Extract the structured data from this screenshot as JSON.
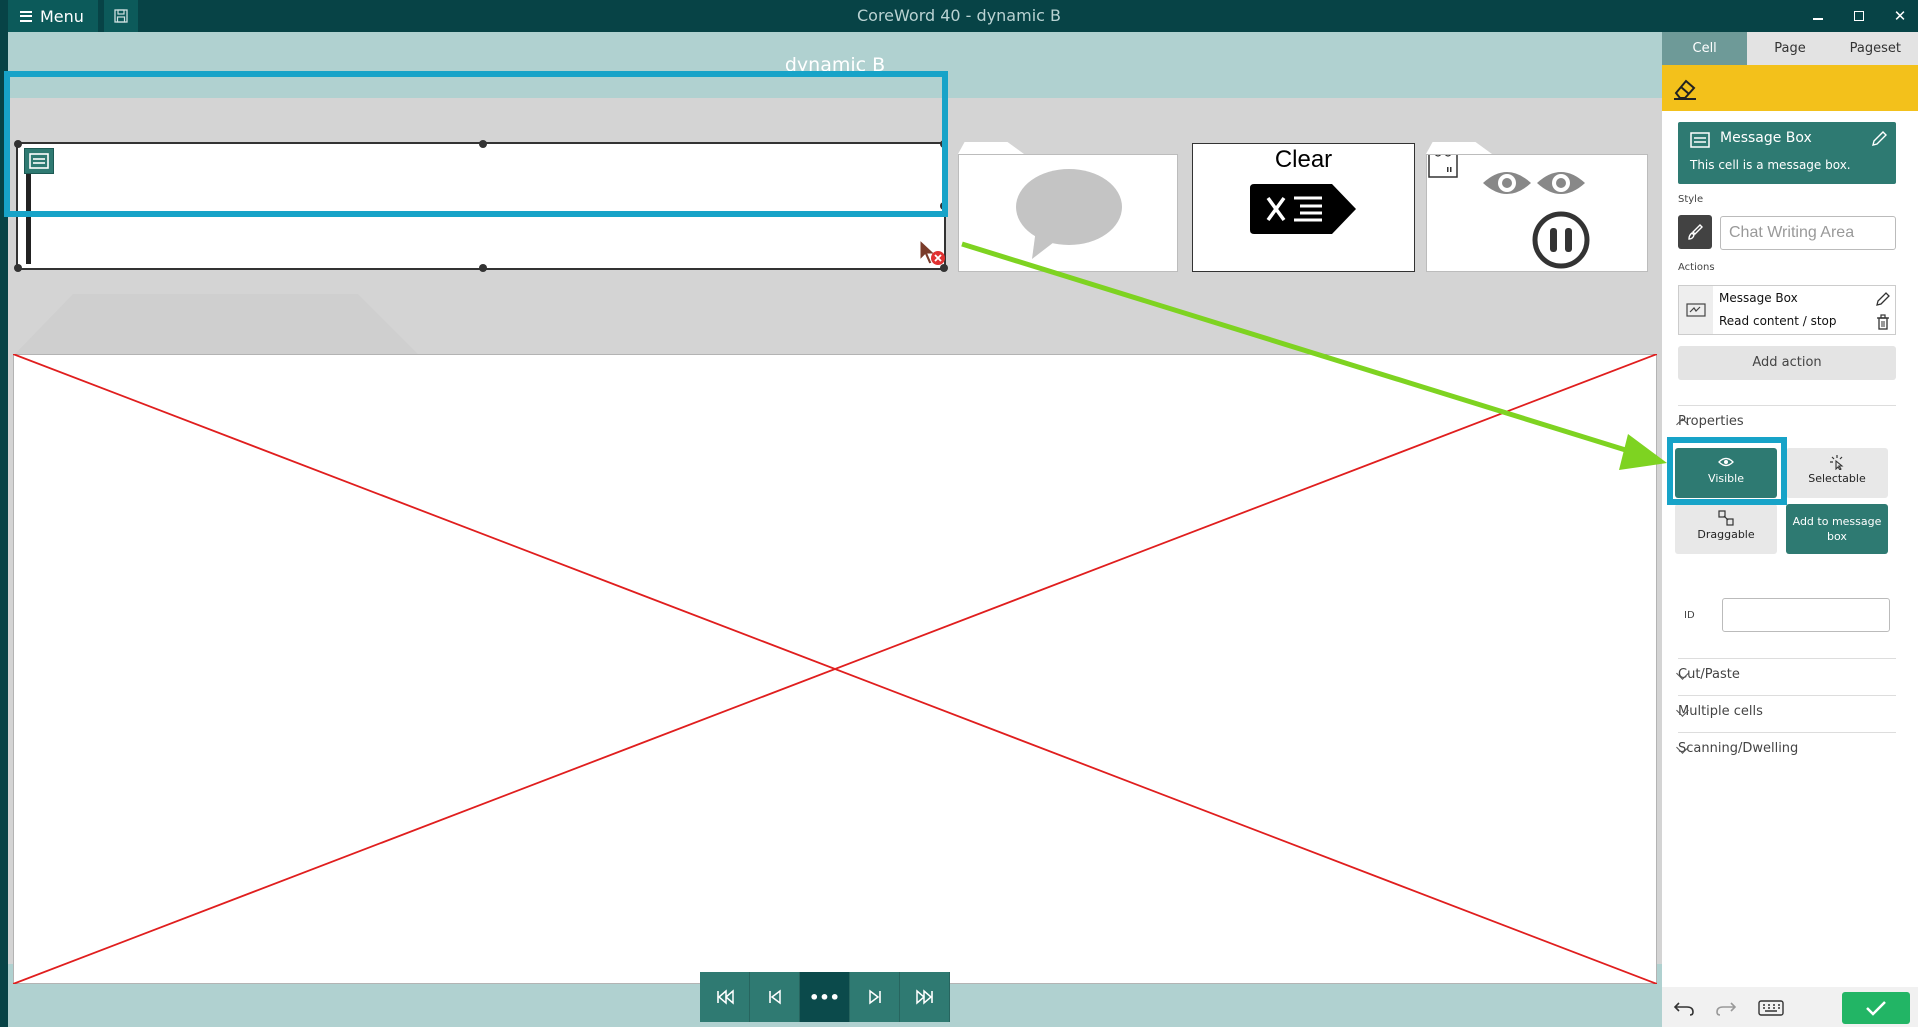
{
  "window": {
    "title": "CoreWord 40 - dynamic B",
    "menu_label": "Menu"
  },
  "editor": {
    "page_title": "dynamic B",
    "clear_label": "Clear"
  },
  "panel": {
    "tabs": [
      {
        "label": "Cell",
        "active": true
      },
      {
        "label": "Page",
        "active": false
      },
      {
        "label": "Pageset",
        "active": false
      }
    ],
    "cell_card": {
      "title": "Message Box",
      "description": "This cell is a message box."
    },
    "style_label": "Style",
    "style_value": "Chat Writing Area",
    "actions_label": "Actions",
    "action": {
      "name": "Message Box",
      "detail": "Read content / stop"
    },
    "add_action_label": "Add action",
    "properties_label": "Properties",
    "properties": {
      "visible": "Visible",
      "selectable": "Selectable",
      "draggable": "Draggable",
      "add_to_message_box": "Add to message box"
    },
    "id_label": "ID",
    "id_value": "",
    "sections": {
      "cut_paste": "Cut/Paste",
      "multiple_cells": "Multiple cells",
      "scanning_dwelling": "Scanning/Dwelling"
    }
  },
  "colors": {
    "titlebar": "#074346",
    "editor_bg": "#b0d1d0",
    "accent_teal": "#2e7a72",
    "highlight": "#17a3c8",
    "arrow": "#7ed321",
    "toolbar_yellow": "#f3c11b",
    "ok_green": "#22b565"
  }
}
